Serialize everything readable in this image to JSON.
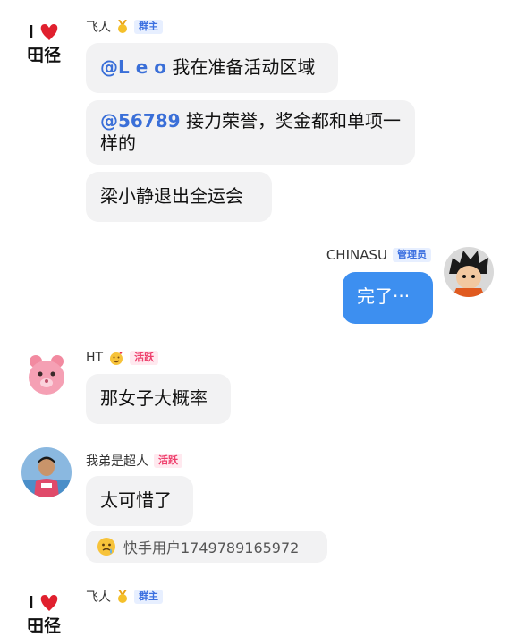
{
  "messages": [
    {
      "sender": "飞人",
      "badge": "群主",
      "avatar_text_top": "I",
      "avatar_text_bottom": "田径",
      "bubbles": [
        {
          "mention": "@L e o",
          "text": " 我在准备活动区域"
        },
        {
          "mention": "@56789",
          "text": " 接力荣誉，奖金都和单项一样的"
        },
        {
          "mention": "",
          "text": "梁小静退出全运会"
        }
      ]
    },
    {
      "sender": "CHINASU",
      "badge": "管理员",
      "bubbles": [
        {
          "text": "完了···"
        }
      ]
    },
    {
      "sender": "HT",
      "badge": "活跃",
      "bubbles": [
        {
          "text": "那女子大概率"
        }
      ]
    },
    {
      "sender": "我弟是超人",
      "badge": "活跃",
      "bubbles": [
        {
          "text": "太可惜了"
        }
      ],
      "reply_ref": {
        "user": "快手用户1749789165972"
      }
    },
    {
      "sender": "飞人",
      "badge": "群主",
      "avatar_text_top": "I",
      "avatar_text_bottom": "田径"
    }
  ],
  "colors": {
    "mention": "#3a6fd8",
    "bubble_gray": "#f2f2f3",
    "bubble_blue": "#3d8ff0",
    "owner_badge": "#3b6fe0",
    "active_badge": "#ee3f6c"
  },
  "icons": {
    "medal": "medal-icon",
    "heart": "heart-icon",
    "emoji_face": "emoji-face-icon",
    "smile_hearts": "smiling-face-hearts-icon"
  }
}
